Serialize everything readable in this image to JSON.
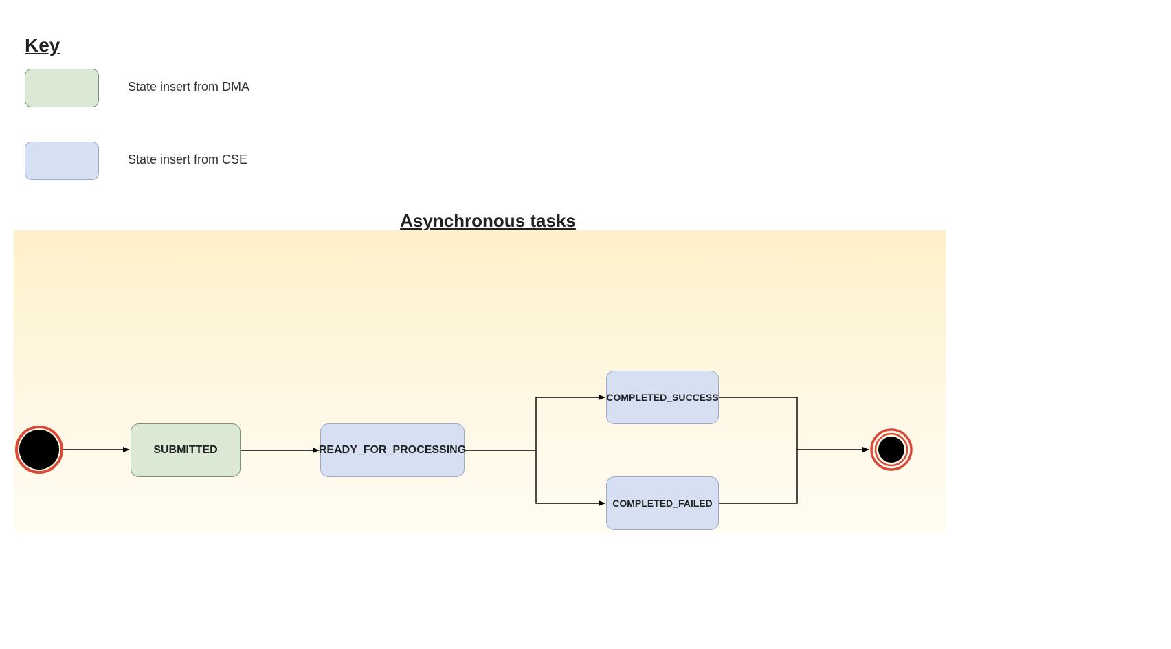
{
  "key": {
    "title": "Key",
    "items": [
      {
        "label": "State insert from DMA",
        "color": "#DAE8D4",
        "border": "#7A9473"
      },
      {
        "label": "State insert from CSE",
        "color": "#D6E0F2",
        "border": "#9AA9C7"
      }
    ]
  },
  "flow": {
    "title": "Asynchronous tasks",
    "bg_gradient_top": "#FEF0C8",
    "bg_gradient_bottom": "#FFFCF2",
    "start_fill": "#000000",
    "start_ring": "#D94A3A",
    "end_fill": "#000000",
    "end_ring": "#D94A3A",
    "states": {
      "submitted": {
        "label": "SUBMITTED",
        "type": "dma"
      },
      "ready": {
        "label": "READY_FOR_PROCESSING",
        "type": "cse"
      },
      "success": {
        "label": "COMPLETED_SUCCESS",
        "type": "cse"
      },
      "failed": {
        "label": "COMPLETED_FAILED",
        "type": "cse"
      }
    },
    "transitions": [
      {
        "from": "start",
        "to": "submitted"
      },
      {
        "from": "submitted",
        "to": "ready"
      },
      {
        "from": "ready",
        "to": "success"
      },
      {
        "from": "ready",
        "to": "failed"
      },
      {
        "from": "success",
        "to": "end"
      },
      {
        "from": "failed",
        "to": "end"
      }
    ]
  }
}
